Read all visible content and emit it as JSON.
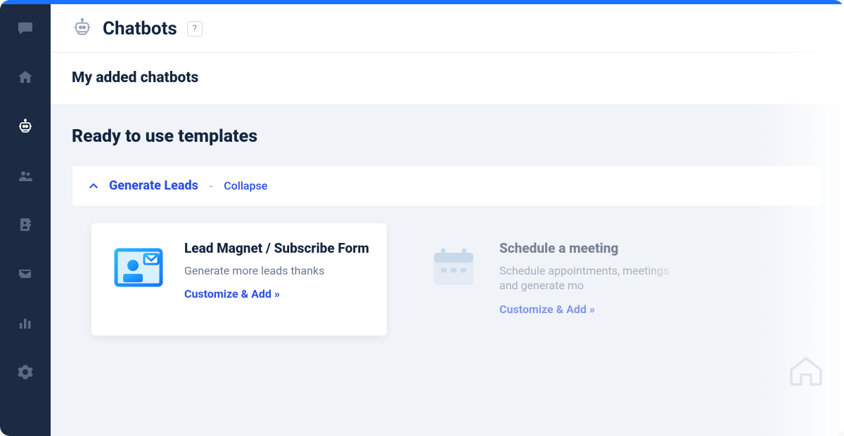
{
  "header": {
    "title": "Chatbots",
    "help_glyph": "?"
  },
  "sidebar": {
    "items": [
      {
        "name": "chat",
        "icon": "chat-icon"
      },
      {
        "name": "home",
        "icon": "home-icon"
      },
      {
        "name": "chatbots",
        "icon": "bot-icon",
        "active": true
      },
      {
        "name": "people",
        "icon": "people-icon"
      },
      {
        "name": "contacts",
        "icon": "contacts-icon"
      },
      {
        "name": "mail",
        "icon": "mail-icon"
      },
      {
        "name": "analytics",
        "icon": "analytics-icon"
      },
      {
        "name": "settings",
        "icon": "gear-icon"
      }
    ]
  },
  "my_added_section": {
    "title": "My added chatbots"
  },
  "templates_section": {
    "title": "Ready to use templates",
    "groups": [
      {
        "title": "Generate Leads",
        "toggle_label": "Collapse",
        "expanded": true,
        "cards": [
          {
            "title": "Lead Magnet / Subscribe Form",
            "description": "Generate more leads thanks",
            "cta": "Customize & Add »",
            "icon": "lead-card-icon"
          },
          {
            "title": "Schedule a meeting",
            "description": "Schedule appointments, meetings and generate mo",
            "cta": "Customize & Add »",
            "icon": "calendar-icon",
            "faded": true
          }
        ]
      }
    ]
  }
}
